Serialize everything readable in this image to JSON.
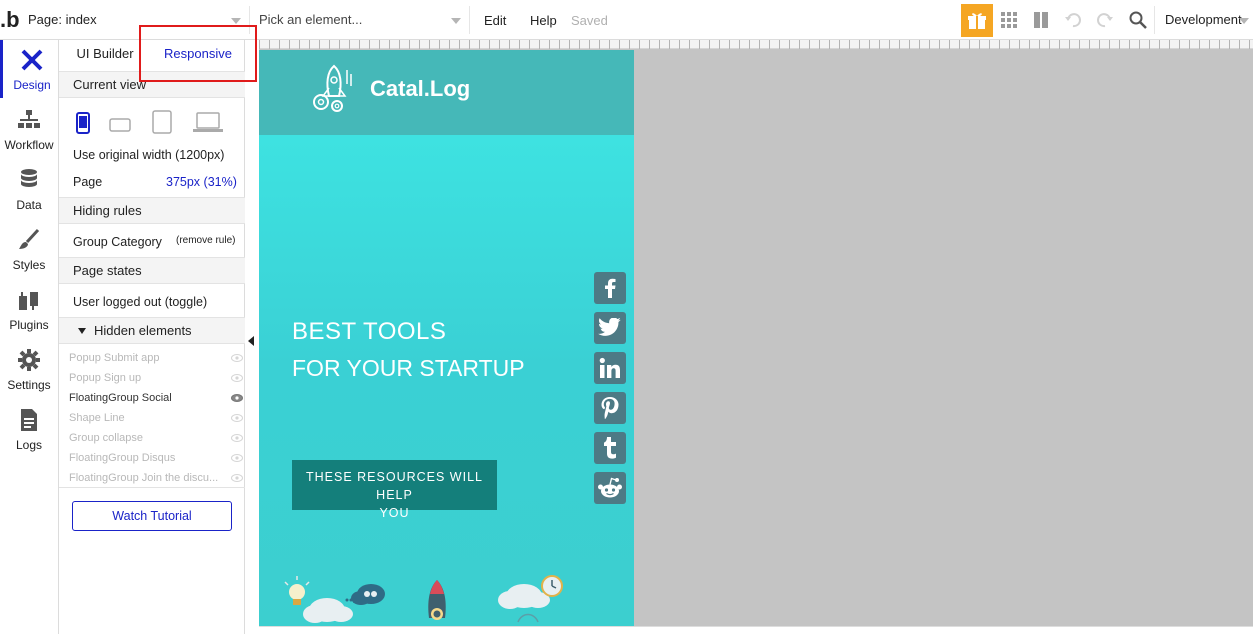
{
  "topbar": {
    "logo": ".b",
    "page_select": "Page: index",
    "element_select": "Pick an element...",
    "menu_edit": "Edit",
    "menu_help": "Help",
    "saved": "Saved",
    "environment": "Development"
  },
  "leftnav": [
    {
      "label": "Design",
      "icon": "design-icon"
    },
    {
      "label": "Workflow",
      "icon": "workflow-icon"
    },
    {
      "label": "Data",
      "icon": "database-icon"
    },
    {
      "label": "Styles",
      "icon": "brush-icon"
    },
    {
      "label": "Plugins",
      "icon": "plugin-icon"
    },
    {
      "label": "Settings",
      "icon": "gear-icon"
    },
    {
      "label": "Logs",
      "icon": "document-icon"
    }
  ],
  "panel": {
    "tab_ui": "UI Builder",
    "tab_responsive": "Responsive",
    "current_view": "Current view",
    "use_original": "Use original width (1200px)",
    "page_label": "Page",
    "page_value": "375px (31%)",
    "hiding_rules": "Hiding rules",
    "group_category": "Group Category",
    "remove_rule": "(remove rule)",
    "page_states": "Page states",
    "user_logged_out": "User logged out (toggle)",
    "hidden_elements": "Hidden elements",
    "hidden_items": [
      {
        "label": "Popup Submit app",
        "visible": false
      },
      {
        "label": "Popup Sign up",
        "visible": false
      },
      {
        "label": "FloatingGroup Social",
        "visible": true
      },
      {
        "label": "Shape Line",
        "visible": false
      },
      {
        "label": "Group collapse",
        "visible": false
      },
      {
        "label": "FloatingGroup Disqus",
        "visible": false
      },
      {
        "label": "FloatingGroup Join the discu...",
        "visible": false
      }
    ],
    "watch_tutorial": "Watch Tutorial"
  },
  "preview": {
    "brand": "Catal.Log",
    "hero_line1": "BEST  TOOLS",
    "hero_line2": "FOR YOUR STARTUP",
    "cta_line1": "THESE RESOURCES WILL HELP",
    "cta_line2": "YOU",
    "social_icons": [
      "facebook-icon",
      "twitter-icon",
      "linkedin-icon",
      "pinterest-icon",
      "tumblr-icon",
      "reddit-icon"
    ]
  },
  "colors": {
    "accent": "#1a23c8",
    "highlight_box": "#e01b1b",
    "gift": "#f5a623",
    "header_band": "#45b8b8",
    "cta": "#147f7b",
    "social": "#4d7a85",
    "canvas_bg": "#c4c4c4"
  }
}
